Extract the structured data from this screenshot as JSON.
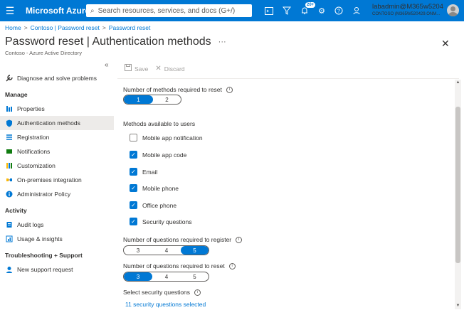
{
  "topbar": {
    "brand": "Microsoft Azure",
    "search_placeholder": "Search resources, services, and docs (G+/)",
    "notification_count": "20+",
    "user": "labadmin@M365w5204...",
    "tenant": "CONTOSO (M365W520429.ONM..."
  },
  "breadcrumb": [
    "Home",
    "Contoso | Password reset",
    "Password reset"
  ],
  "title": {
    "main": "Password reset",
    "sep": " | ",
    "sub": "Authentication methods",
    "more": "···",
    "subtitle": "Contoso - Azure Active Directory"
  },
  "sidebar": {
    "collapse": "«",
    "items": [
      {
        "label": "Diagnose and solve problems",
        "icon": "wrench-icon"
      },
      {
        "section": "Manage"
      },
      {
        "label": "Properties",
        "icon": "properties-icon"
      },
      {
        "label": "Authentication methods",
        "icon": "shield-icon",
        "active": true
      },
      {
        "label": "Registration",
        "icon": "list-icon"
      },
      {
        "label": "Notifications",
        "icon": "notification-icon"
      },
      {
        "label": "Customization",
        "icon": "customization-icon"
      },
      {
        "label": "On-premises integration",
        "icon": "integration-icon"
      },
      {
        "label": "Administrator Policy",
        "icon": "info-icon"
      },
      {
        "section": "Activity"
      },
      {
        "label": "Audit logs",
        "icon": "audit-log-icon"
      },
      {
        "label": "Usage & insights",
        "icon": "insights-icon"
      },
      {
        "section": "Troubleshooting + Support"
      },
      {
        "label": "New support request",
        "icon": "support-icon"
      }
    ]
  },
  "toolbar": {
    "save": "Save",
    "discard": "Discard"
  },
  "methods_required": {
    "label": "Number of methods required to reset",
    "options": [
      "1",
      "2"
    ],
    "selected": "1"
  },
  "methods_available": {
    "label": "Methods available to users",
    "items": [
      {
        "label": "Mobile app notification",
        "checked": false
      },
      {
        "label": "Mobile app code",
        "checked": true
      },
      {
        "label": "Email",
        "checked": true
      },
      {
        "label": "Mobile phone",
        "checked": true
      },
      {
        "label": "Office phone",
        "checked": true
      },
      {
        "label": "Security questions",
        "checked": true
      }
    ]
  },
  "questions_register": {
    "label": "Number of questions required to register",
    "options": [
      "3",
      "4",
      "5"
    ],
    "selected": "5"
  },
  "questions_reset": {
    "label": "Number of questions required to reset",
    "options": [
      "3",
      "4",
      "5"
    ],
    "selected": "3"
  },
  "security_questions": {
    "label": "Select security questions",
    "link": "11 security questions selected"
  }
}
